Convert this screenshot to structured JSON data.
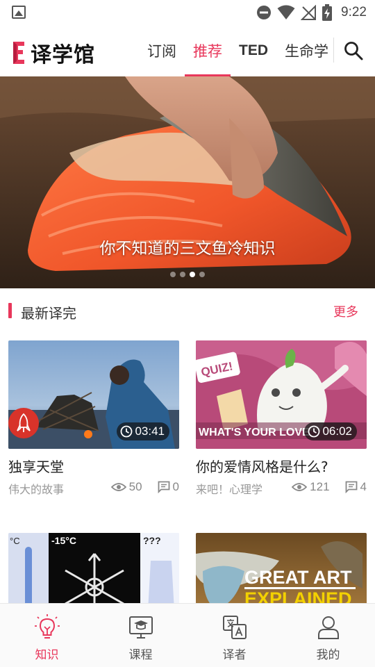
{
  "status_bar": {
    "time": "9:22"
  },
  "app": {
    "logo_text": "译学馆",
    "brand_color": "#e8375b"
  },
  "nav_tabs": [
    {
      "label": "订阅",
      "active": false
    },
    {
      "label": "推荐",
      "active": true
    },
    {
      "label": "TED",
      "active": false
    },
    {
      "label": "生命学",
      "active": false
    }
  ],
  "banner": {
    "caption": "你不知道的三文鱼冷知识",
    "slides": 4,
    "current_slide": 3
  },
  "section": {
    "title": "最新译完",
    "more_label": "更多"
  },
  "cards": [
    {
      "title": "独享天堂",
      "source": "伟大的故事",
      "duration": "03:41",
      "views": "50",
      "comments": "0"
    },
    {
      "title": "你的爱情风格是什么?",
      "source": "来吧！心理学",
      "duration": "06:02",
      "views": "121",
      "comments": "4"
    },
    {
      "thumb_labels": [
        "°C",
        "-15°C",
        "???"
      ]
    },
    {
      "thumb_labels": [
        "GREAT ART",
        "EXPLAINED"
      ]
    }
  ],
  "thumb2_text": {
    "quiz": "QUIZ!",
    "banner": "WHAT'S YOUR LOVE"
  },
  "bottom_nav": [
    {
      "label": "知识",
      "icon": "lightbulb-icon",
      "active": true
    },
    {
      "label": "课程",
      "icon": "monitor-cap-icon",
      "active": false
    },
    {
      "label": "译者",
      "icon": "translate-icon",
      "active": false
    },
    {
      "label": "我的",
      "icon": "person-icon",
      "active": false
    }
  ]
}
